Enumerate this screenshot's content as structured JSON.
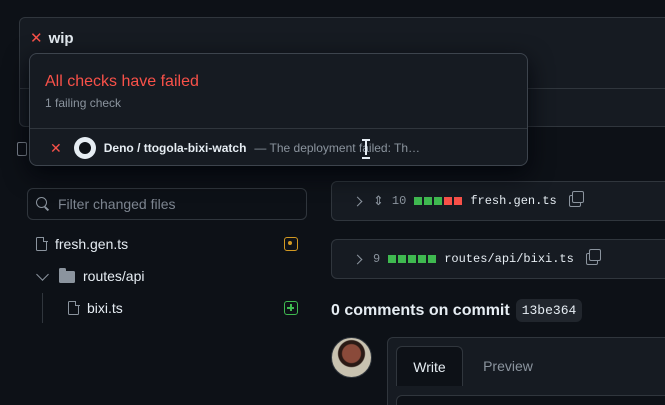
{
  "commit": {
    "title": "wip"
  },
  "checks_popover": {
    "title": "All checks have failed",
    "subtitle": "1 failing check",
    "check": {
      "name": "Deno / ttogola-bixi-watch",
      "description": "— The deployment failed: Th…"
    }
  },
  "file_filter": {
    "placeholder": "Filter changed files"
  },
  "file_tree": {
    "file1": "fresh.gen.ts",
    "folder": "routes/api",
    "file2": "bixi.ts"
  },
  "diffs": [
    {
      "count": "10",
      "filename": "fresh.gen.ts",
      "blocks": [
        "#3fb950",
        "#3fb950",
        "#3fb950",
        "#f85149",
        "#f85149"
      ]
    },
    {
      "count": "9",
      "filename": "routes/api/bixi.ts",
      "blocks": [
        "#3fb950",
        "#3fb950",
        "#3fb950",
        "#3fb950",
        "#3fb950"
      ]
    }
  ],
  "comments": {
    "title": "0 comments on commit",
    "sha": "13be364",
    "tab_write": "Write",
    "tab_preview": "Preview"
  },
  "icons": {
    "fail": "x-icon",
    "search": "search-icon",
    "file": "file-icon",
    "folder": "folder-icon",
    "modified": "file-diff-modified-icon",
    "added": "file-diff-added-icon",
    "copy": "copy-icon",
    "expand": "unfold-icon"
  },
  "colors": {
    "danger": "#f85149",
    "success": "#3fb950",
    "attention": "#d29922"
  }
}
